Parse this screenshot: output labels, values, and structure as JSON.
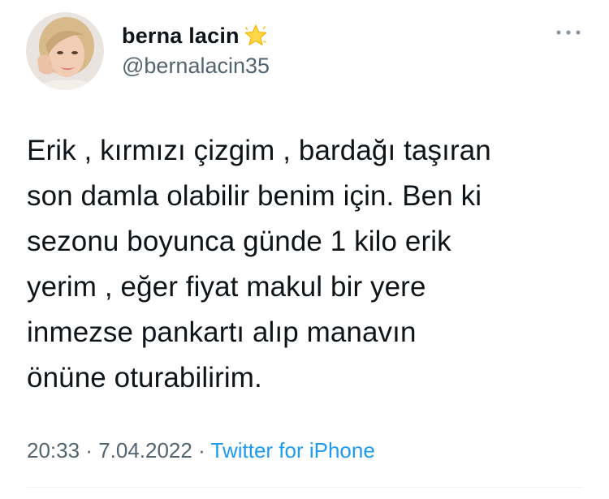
{
  "user": {
    "display_name": "berna lacin",
    "badge_icon": "star-emoji-icon",
    "handle": "@bernalacin35",
    "avatar_icon": "profile-photo-avatar"
  },
  "more_icon": "more-options-icon",
  "tweet": {
    "lines": [
      "Erik , kırmızı çizgim , bardağı taşıran",
      "son damla olabilir benim için. Ben ki",
      "sezonu boyunca günde 1 kilo erik",
      "yerim , eğer fiyat makul bir yere",
      "inmezse pankartı alıp manavın",
      "önüne oturabilirim."
    ]
  },
  "meta": {
    "time": "20:33",
    "separator1": " · ",
    "date": "7.04.2022",
    "separator2": " · ",
    "source": "Twitter for iPhone"
  },
  "colors": {
    "text": "#0f1419",
    "secondary": "#536471",
    "link": "#1d9bf0",
    "divider": "#eff3f4"
  }
}
